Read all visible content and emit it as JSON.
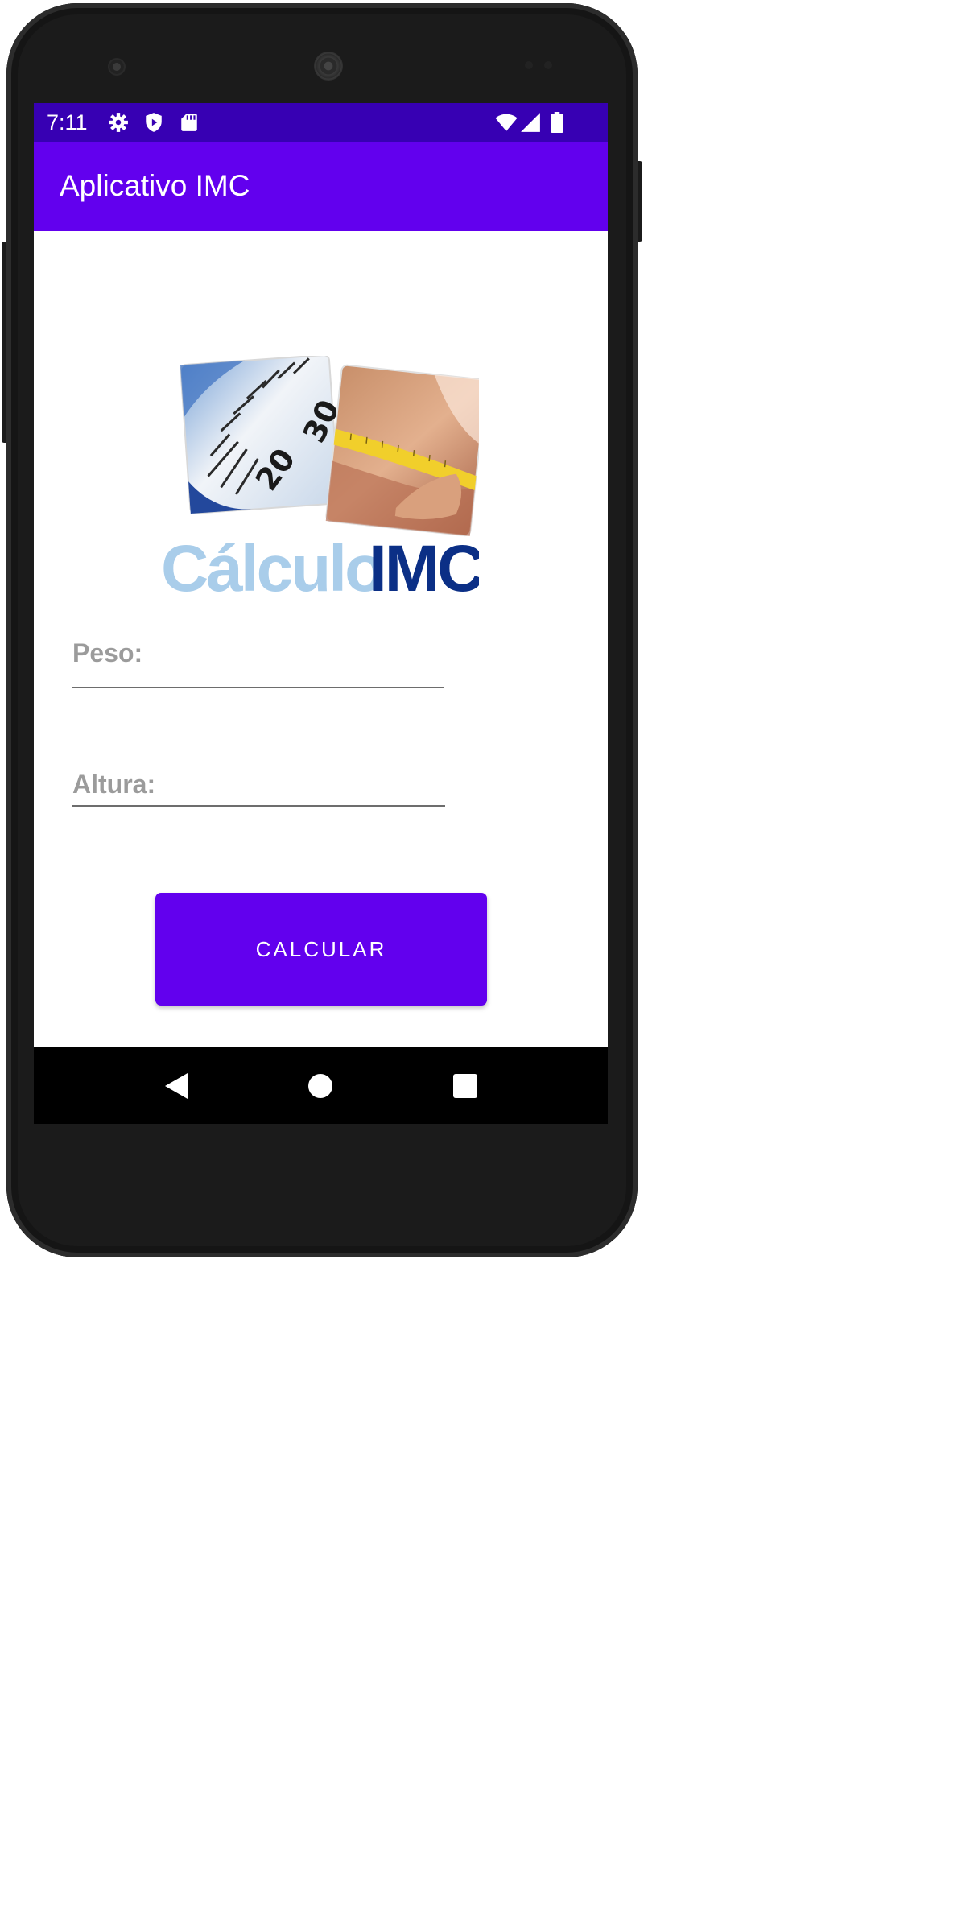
{
  "status_bar": {
    "time": "7:11",
    "icons": [
      "gear-icon",
      "shield-play-icon",
      "sd-card-icon",
      "wifi-icon",
      "signal-icon",
      "battery-icon"
    ],
    "background": "#3700b3"
  },
  "app_bar": {
    "title": "Aplicativo IMC",
    "background": "#6200ee"
  },
  "logo": {
    "word_light": "Cálculo",
    "word_dark": "IMC",
    "scale_numbers": [
      "20",
      "30"
    ],
    "colors": {
      "light": "#a9cdea",
      "dark": "#0b2f86"
    }
  },
  "form": {
    "peso_placeholder": "Peso:",
    "altura_placeholder": "Altura:"
  },
  "calculate_button": {
    "label": "CALCULAR",
    "background": "#6200ee"
  },
  "nav_bar": {
    "icons": [
      "back-icon",
      "home-icon",
      "recents-icon"
    ]
  }
}
